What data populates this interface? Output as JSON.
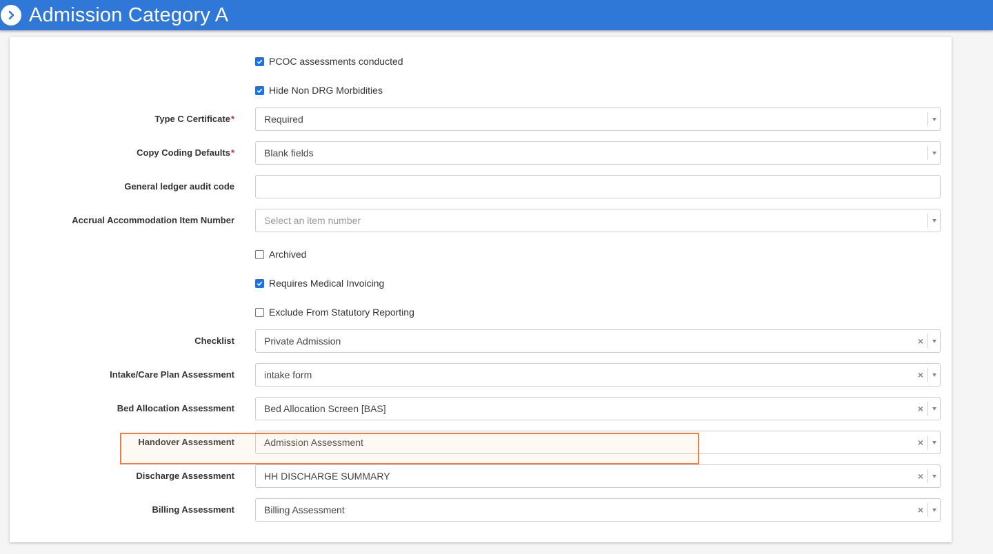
{
  "header": {
    "title": "Admission Category A"
  },
  "checkboxes_top": [
    {
      "label": "PCOC assessments conducted",
      "checked": true
    },
    {
      "label": "Hide Non DRG Morbidities",
      "checked": true
    }
  ],
  "fields_top": [
    {
      "label": "Type C Certificate",
      "required": "*",
      "value": "Required"
    },
    {
      "label": "Copy Coding Defaults",
      "required": "*",
      "value": "Blank fields"
    },
    {
      "label": "General ledger audit code",
      "value": ""
    },
    {
      "label": "Accrual Accommodation Item Number",
      "placeholder": "Select an item number"
    }
  ],
  "checkboxes_mid": [
    {
      "label": "Archived",
      "checked": false
    },
    {
      "label": "Requires Medical Invoicing",
      "checked": true
    },
    {
      "label": "Exclude From Statutory Reporting",
      "checked": false
    }
  ],
  "assessments": [
    {
      "label": "Checklist",
      "value": "Private Admission"
    },
    {
      "label": "Intake/Care Plan Assessment",
      "value": "intake form"
    },
    {
      "label": "Bed Allocation Assessment",
      "value": "Bed Allocation Screen [BAS]"
    },
    {
      "label": "Handover Assessment",
      "value": "Admission Assessment"
    },
    {
      "label": "Discharge Assessment",
      "value": "HH DISCHARGE SUMMARY"
    },
    {
      "label": "Billing Assessment",
      "value": "Billing Assessment"
    }
  ],
  "icons": {
    "clear": "×",
    "back": "chevron-right-icon",
    "dropdown": "caret-down-icon"
  },
  "colors": {
    "header": "#2f78d8",
    "required": "#d9232d",
    "checkbox": "#1a73e8",
    "highlight": "#f08040"
  }
}
